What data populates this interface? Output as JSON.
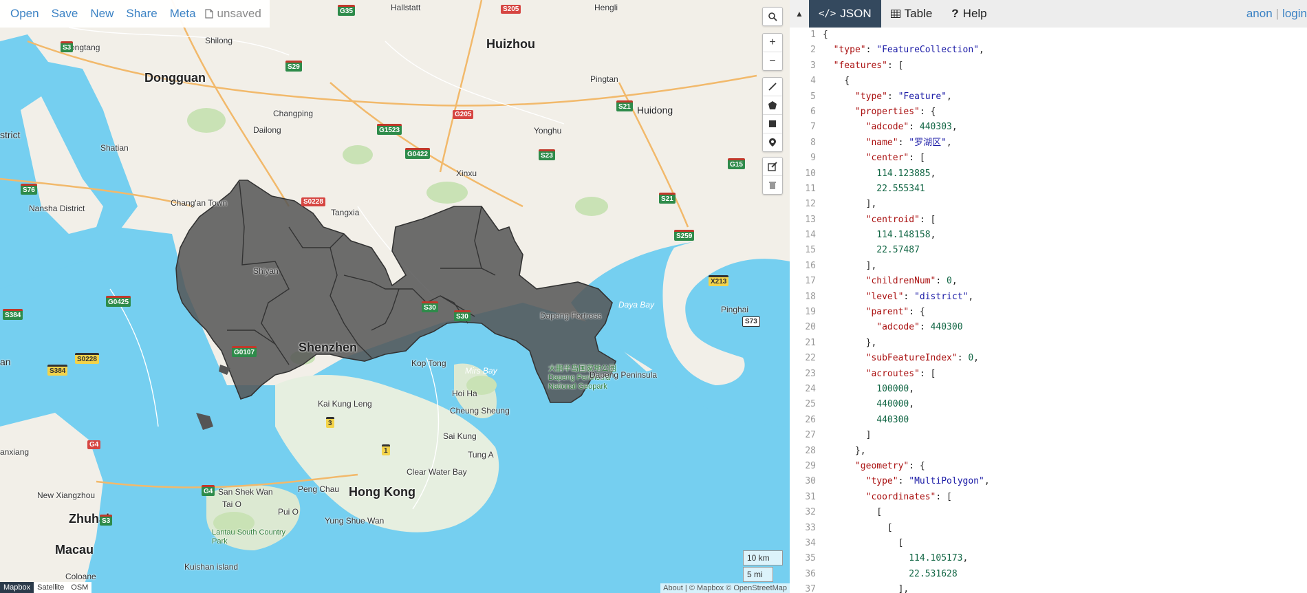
{
  "toolbar": {
    "menu": [
      "Open",
      "Save",
      "New",
      "Share",
      "Meta"
    ],
    "doc_status": "unsaved"
  },
  "map": {
    "controls": {
      "search_icon": "search-icon",
      "zoom_in": "+",
      "zoom_out": "−",
      "draw_tools": [
        "draw-line-icon",
        "draw-polygon-icon",
        "draw-rectangle-icon",
        "draw-marker-icon"
      ],
      "edit_tools": [
        "edit-icon",
        "trash-icon"
      ]
    },
    "scale": {
      "km": "10 km",
      "mi": "5 mi"
    },
    "attribution_left": [
      "Mapbox",
      "Satellite",
      "OSM"
    ],
    "attribution_right": "About | © Mapbox © OpenStreetMap",
    "places": [
      {
        "name": "Hallstatt",
        "size": "s"
      },
      {
        "name": "Hengli",
        "size": "s"
      },
      {
        "name": "Zhongtang",
        "size": "s"
      },
      {
        "name": "Shilong",
        "size": "s"
      },
      {
        "name": "Huizhou",
        "size": "l"
      },
      {
        "name": "Dongguan",
        "size": "l"
      },
      {
        "name": "Pingtan",
        "size": "s"
      },
      {
        "name": "Huidong",
        "size": "m"
      },
      {
        "name": "Changping",
        "size": "s"
      },
      {
        "name": "strict",
        "size": "m"
      },
      {
        "name": "Dailong",
        "size": "s"
      },
      {
        "name": "Yonghu",
        "size": "s"
      },
      {
        "name": "Shatian",
        "size": "s"
      },
      {
        "name": "Xinxu",
        "size": "s"
      },
      {
        "name": "Chang'an Town",
        "size": "s"
      },
      {
        "name": "Tangxia",
        "size": "s"
      },
      {
        "name": "Nansha District",
        "size": "s"
      },
      {
        "name": "Shiyan",
        "size": "s"
      },
      {
        "name": "Shenzhen",
        "size": "l"
      },
      {
        "name": "Dapeng Fortress",
        "size": "s"
      },
      {
        "name": "Daya Bay",
        "size": "w"
      },
      {
        "name": "Pinghai",
        "size": "s"
      },
      {
        "name": "Kop Tong",
        "size": "s"
      },
      {
        "name": "Mirs Bay",
        "size": "w"
      },
      {
        "name": "Hoi Ha",
        "size": "s"
      },
      {
        "name": "Kai Kung Leng",
        "size": "s"
      },
      {
        "name": "Cheung Sheung",
        "size": "s"
      },
      {
        "name": "Sai Kung",
        "size": "s"
      },
      {
        "name": "Tung A",
        "size": "s"
      },
      {
        "name": "an",
        "size": "m"
      },
      {
        "name": "anxiang",
        "size": "s"
      },
      {
        "name": "Clear Water Bay",
        "size": "s"
      },
      {
        "name": "San Shek Wan",
        "size": "s"
      },
      {
        "name": "Peng Chau",
        "size": "s"
      },
      {
        "name": "Hong Kong",
        "size": "l"
      },
      {
        "name": "New Xiangzhou",
        "size": "s"
      },
      {
        "name": "Tai O",
        "size": "s"
      },
      {
        "name": "Pui O",
        "size": "s"
      },
      {
        "name": "Zhuhai",
        "size": "l"
      },
      {
        "name": "Yung Shue Wan",
        "size": "s"
      },
      {
        "name": "Lantau South Country Park",
        "size": "p"
      },
      {
        "name": "Macau",
        "size": "l"
      },
      {
        "name": "Kuishan island",
        "size": "s"
      },
      {
        "name": "Coloane",
        "size": "s"
      },
      {
        "name": "大鹏半岛国家地公园 Dapeng Peninsula National Geopark",
        "size": "p"
      },
      {
        "name": "Dapeng Peninsula",
        "size": "s"
      }
    ],
    "shields": [
      "G35",
      "S205",
      "S3",
      "S29",
      "G1523",
      "G205",
      "G0422",
      "S23",
      "S21",
      "G15",
      "S76",
      "S0228",
      "S21",
      "S259",
      "X213",
      "S73",
      "G0425",
      "S384",
      "S384",
      "S0228",
      "G4",
      "G4",
      "S3",
      "G0107",
      "3",
      "1",
      "S30",
      "S30"
    ]
  },
  "pane": {
    "collapse_icon": "caret-up-icon",
    "tabs": [
      {
        "icon": "code-icon",
        "label": "JSON"
      },
      {
        "icon": "table-icon",
        "label": "Table"
      },
      {
        "icon": "help-icon",
        "label": "Help"
      }
    ],
    "auth": {
      "anon": "anon",
      "sep": "|",
      "login": "login"
    }
  },
  "editor": {
    "lines": [
      "{",
      "  \"type\": \"FeatureCollection\",",
      "  \"features\": [",
      "    {",
      "      \"type\": \"Feature\",",
      "      \"properties\": {",
      "        \"adcode\": 440303,",
      "        \"name\": \"罗湖区\",",
      "        \"center\": [",
      "          114.123885,",
      "          22.555341",
      "        ],",
      "        \"centroid\": [",
      "          114.148158,",
      "          22.57487",
      "        ],",
      "        \"childrenNum\": 0,",
      "        \"level\": \"district\",",
      "        \"parent\": {",
      "          \"adcode\": 440300",
      "        },",
      "        \"subFeatureIndex\": 0,",
      "        \"acroutes\": [",
      "          100000,",
      "          440000,",
      "          440300",
      "        ]",
      "      },",
      "      \"geometry\": {",
      "        \"type\": \"MultiPolygon\",",
      "        \"coordinates\": [",
      "          [",
      "            [",
      "              [",
      "                114.105173,",
      "                22.531628",
      "              ],"
    ]
  }
}
